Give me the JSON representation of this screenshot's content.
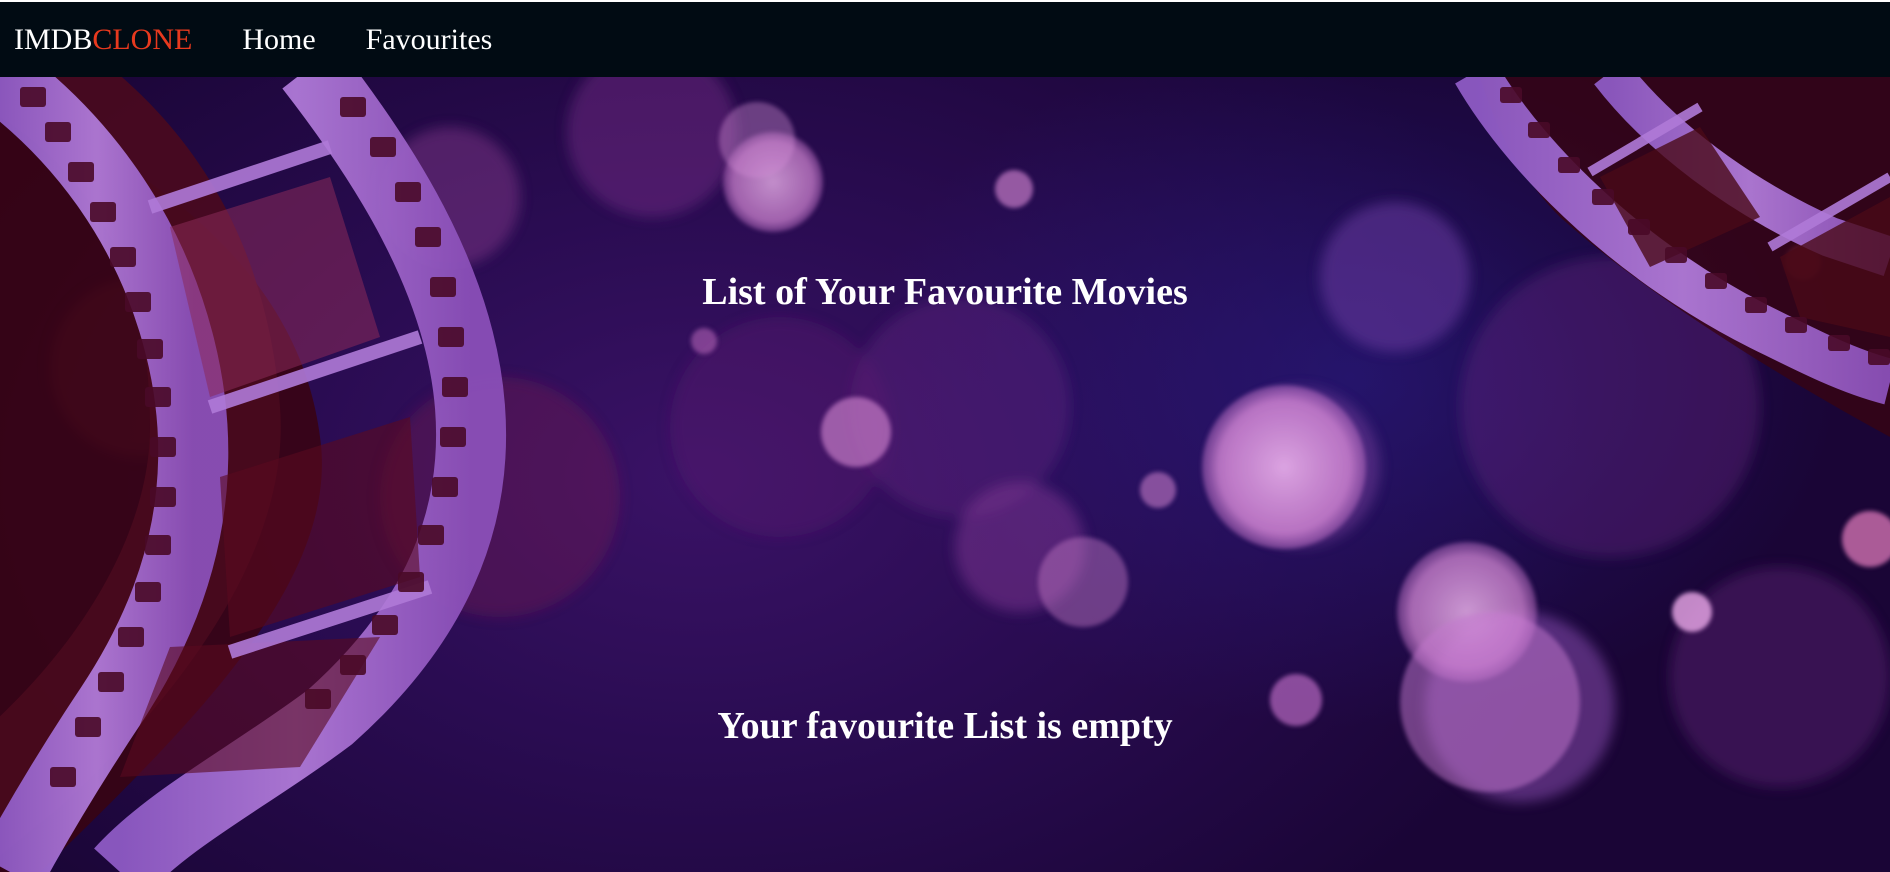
{
  "navbar": {
    "brand_main": "IMDB",
    "brand_accent": "CLONE",
    "links": [
      "Home",
      "Favourites"
    ]
  },
  "main": {
    "title": "List of Your Favourite Movies",
    "empty_message": "Your favourite List is empty"
  },
  "colors": {
    "navbar_bg": "#010b13",
    "brand_accent": "#e8391e",
    "text": "#ffffff",
    "background": "#2a0c52"
  },
  "icons": [
    "film-reel-left",
    "film-reel-right",
    "bokeh-lights"
  ]
}
